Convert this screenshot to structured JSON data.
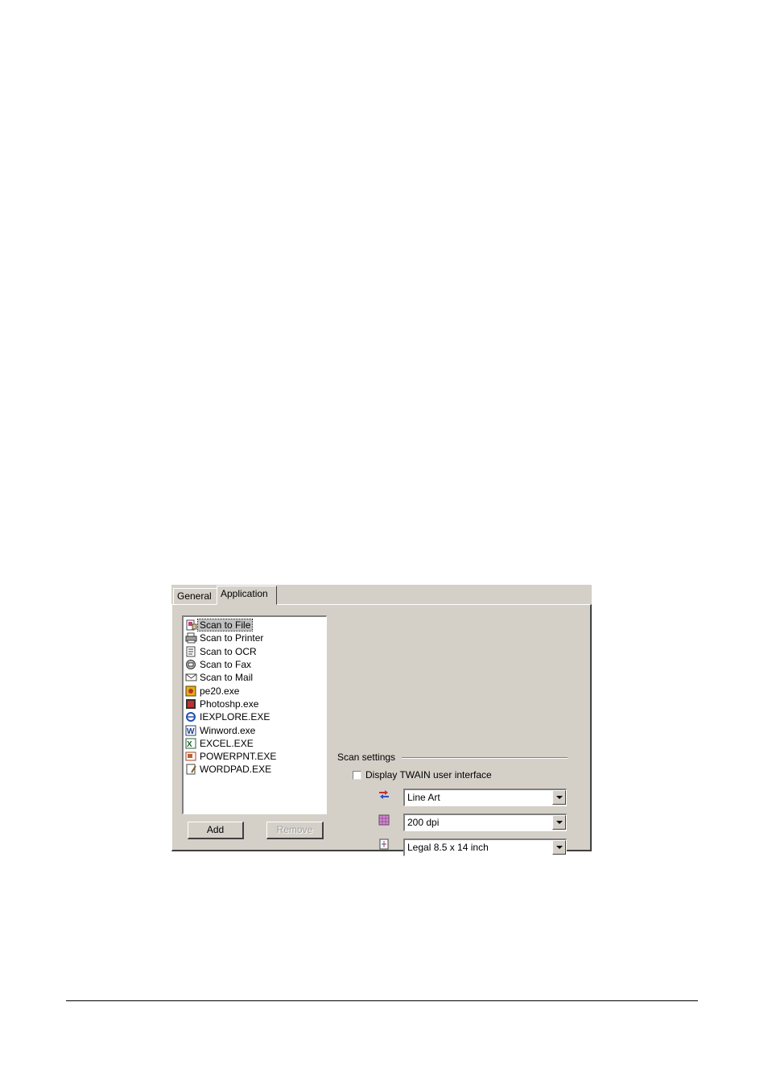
{
  "tabs": [
    {
      "label": "General",
      "active": false
    },
    {
      "label": "Application",
      "active": true
    }
  ],
  "app_list": {
    "selected_index": 0,
    "items": [
      {
        "label": "Scan to File",
        "icon": "scan-file-icon"
      },
      {
        "label": "Scan to Printer",
        "icon": "printer-icon"
      },
      {
        "label": "Scan to OCR",
        "icon": "ocr-icon"
      },
      {
        "label": "Scan to Fax",
        "icon": "fax-icon"
      },
      {
        "label": "Scan to Mail",
        "icon": "mail-icon"
      },
      {
        "label": "pe20.exe",
        "icon": "app-icon"
      },
      {
        "label": "Photoshp.exe",
        "icon": "photoshop-icon"
      },
      {
        "label": "IEXPLORE.EXE",
        "icon": "internet-explorer-icon"
      },
      {
        "label": "Winword.exe",
        "icon": "word-icon"
      },
      {
        "label": "EXCEL.EXE",
        "icon": "excel-icon"
      },
      {
        "label": "POWERPNT.EXE",
        "icon": "powerpoint-icon"
      },
      {
        "label": "WORDPAD.EXE",
        "icon": "wordpad-icon"
      }
    ]
  },
  "buttons": {
    "add": "Add",
    "remove": "Remove"
  },
  "scan_settings": {
    "group_label": "Scan settings",
    "twain_checkbox_label": "Display TWAIN user interface",
    "twain_checked": false,
    "color_mode": "Line Art",
    "resolution": "200 dpi",
    "paper_size": "Legal 8.5 x 14 inch"
  },
  "colors": {
    "dialog_bg": "#d4d0c8",
    "list_bg": "#ffffff",
    "selection": "#c0c0c0"
  }
}
